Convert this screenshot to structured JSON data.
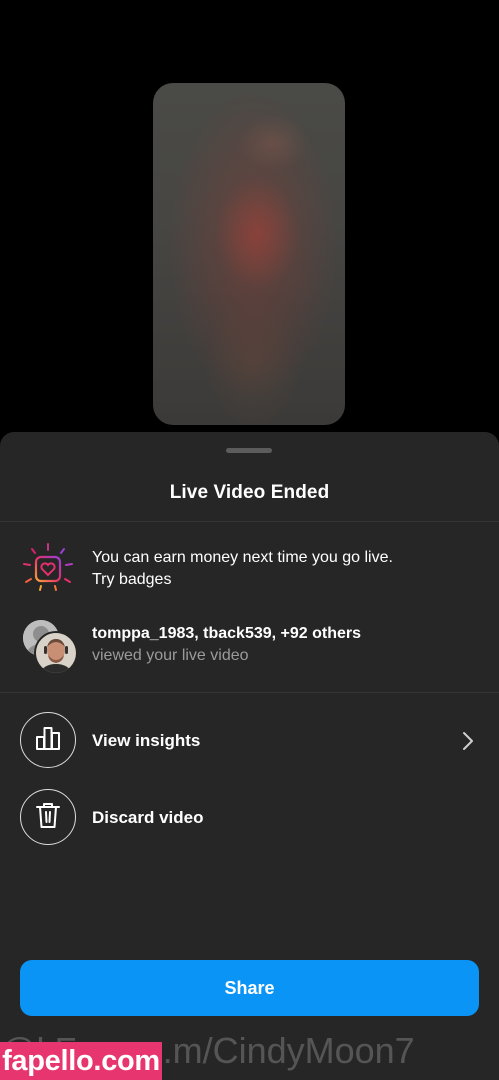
{
  "sheet": {
    "title": "Live Video Ended",
    "badges_line1": "You can earn money next time you go live.",
    "badges_line2": "Try badges",
    "viewers_names": "tomppa_1983, tback539, +92 others",
    "viewers_subtext": "viewed your live video",
    "view_insights_label": "View insights",
    "discard_label": "Discard video",
    "share_label": "Share"
  },
  "watermark": {
    "url_text": "@l.Fans.c.m/CindyMoon7",
    "badge_text": "fapello.com"
  },
  "colors": {
    "sheet_bg": "#262626",
    "share_blue": "#0a95f6",
    "badge_pink": "#e7356f"
  },
  "icons": [
    "badge-heart-icon",
    "bar-chart-icon",
    "trash-icon",
    "chevron-right-icon"
  ]
}
